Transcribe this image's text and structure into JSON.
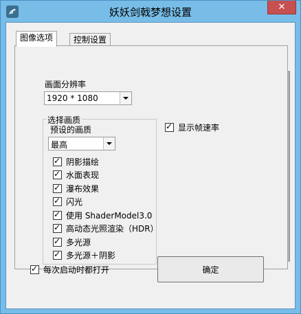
{
  "window": {
    "title": "妖妖剑戟梦想设置",
    "close_label": "✕",
    "app_icon": "dragon-icon"
  },
  "tabs": [
    {
      "label": "图像选项",
      "active": true
    },
    {
      "label": "控制设置",
      "active": false
    }
  ],
  "resolution": {
    "label": "画面分辨率",
    "value": "1920 * 1080"
  },
  "quality_group": {
    "title": "选择画质",
    "preset_label": "预设的画质",
    "preset_value": "最高",
    "options": [
      {
        "label": "阴影描绘",
        "checked": true
      },
      {
        "label": "水面表现",
        "checked": true
      },
      {
        "label": "瀑布效果",
        "checked": true
      },
      {
        "label": "闪光",
        "checked": true
      },
      {
        "label": "使用 ShaderModel3.0",
        "checked": true
      },
      {
        "label": "高动态光照渲染（HDR）",
        "checked": true
      },
      {
        "label": "多光源",
        "checked": true
      },
      {
        "label": "多光源＋阴影",
        "checked": true
      }
    ]
  },
  "show_fps": {
    "label": "显示帧速率",
    "checked": true
  },
  "open_on_start": {
    "label": "每次启动时都打开",
    "checked": true
  },
  "ok_button": {
    "label": "确定"
  }
}
